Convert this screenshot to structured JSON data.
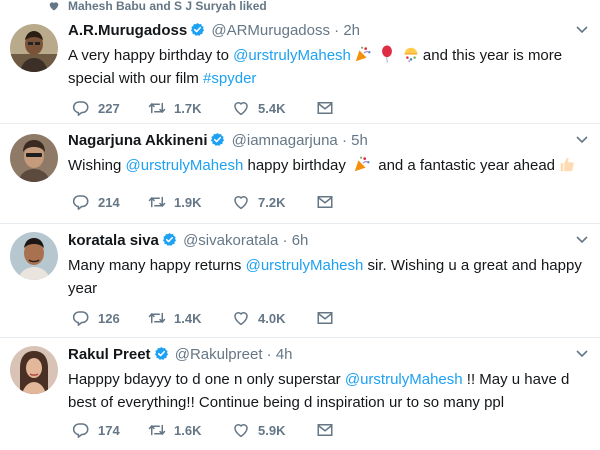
{
  "liked_by": "Mahesh Babu and S J Suryah liked",
  "colors": {
    "link": "#1da1f2",
    "muted": "#657786",
    "text": "#14171a",
    "divider": "#e6ecf0"
  },
  "tweets": [
    {
      "name": "A.R.Murugadoss",
      "handle": "@ARMurugadoss",
      "time": "2h",
      "text_parts": [
        "A very happy birthday to ",
        "@urstrulyMahesh",
        "and this year is more special with our film ",
        "#spyder"
      ],
      "emoji": [
        "party-popper",
        "balloon",
        "confetti-ball"
      ],
      "replies": "227",
      "retweets": "1.7K",
      "likes": "5.4K"
    },
    {
      "name": "Nagarjuna Akkineni",
      "handle": "@iamnagarjuna",
      "time": "5h",
      "text_parts": [
        "Wishing ",
        "@urstrulyMahesh",
        " happy birthday ",
        " and a fantastic year ahead"
      ],
      "emoji": [
        "party-popper",
        "thumbs-up"
      ],
      "replies": "214",
      "retweets": "1.9K",
      "likes": "7.2K"
    },
    {
      "name": "koratala siva",
      "handle": "@sivakoratala",
      "time": "6h",
      "text_parts": [
        "Many many happy returns ",
        "@urstrulyMahesh",
        " sir. Wishing u a great and happy year"
      ],
      "replies": "126",
      "retweets": "1.4K",
      "likes": "4.0K"
    },
    {
      "name": "Rakul Preet",
      "handle": "@Rakulpreet",
      "time": "4h",
      "text_parts": [
        "Happpy bdayyy to d one n only superstar ",
        "@urstrulyMahesh",
        " !! May u have d best of everything!! Continue being d inspiration ur to so many ppl"
      ],
      "replies": "174",
      "retweets": "1.6K",
      "likes": "5.9K"
    }
  ]
}
